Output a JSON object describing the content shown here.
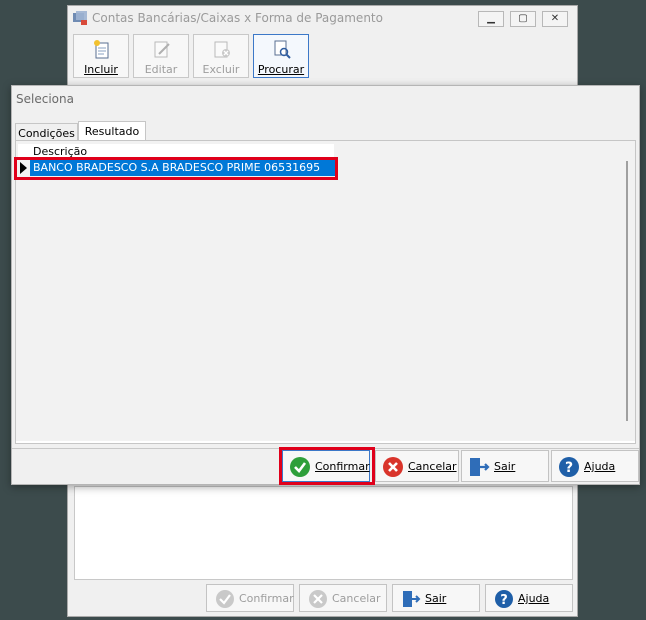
{
  "main_window": {
    "title": "Contas Bancárias/Caixas x Forma de Pagamento",
    "toolbar": {
      "incluir": "Incluir",
      "editar": "Editar",
      "excluir": "Excluir",
      "procurar": "Procurar"
    },
    "footer": {
      "confirmar": "Confirmar",
      "cancelar": "Cancelar",
      "sair": "Sair",
      "ajuda": "Ajuda"
    }
  },
  "dialog": {
    "title": "Seleciona",
    "tabs": [
      {
        "label": "Condições",
        "active": false
      },
      {
        "label": "Resultado",
        "active": true
      }
    ],
    "grid": {
      "column_header": "Descrição",
      "rows": [
        {
          "descricao": "BANCO BRADESCO S.A BRADESCO PRIME 06531695",
          "selected": true
        }
      ]
    },
    "buttons": {
      "confirmar": "Confirmar",
      "cancelar": "Cancelar",
      "sair": "Sair",
      "ajuda": "Ajuda"
    }
  },
  "colors": {
    "selection": "#0078d7",
    "highlight_box": "#e0001b",
    "confirm_green": "#2e9f3a",
    "cancel_red": "#d9342b",
    "help_blue": "#1f5fa8"
  }
}
